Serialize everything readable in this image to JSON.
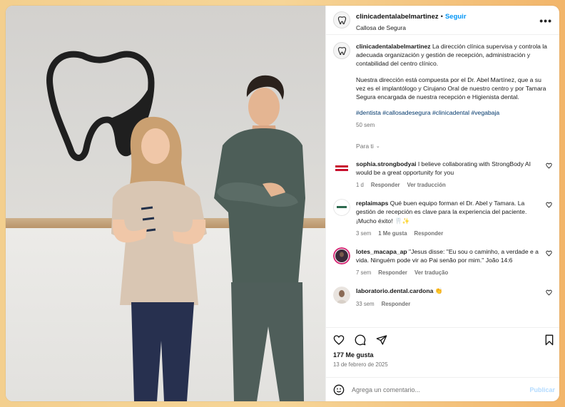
{
  "post": {
    "username": "clinicadentalabelmartinez",
    "separator": "•",
    "follow_label": "Seguir",
    "location": "Callosa de Segura",
    "more_icon": "more-horizontal-icon"
  },
  "caption": {
    "username": "clinicadentalabelmartinez",
    "text1": "La dirección clínica supervisa y controla la adecuada organización y gestión de recepción, administración y contabilidad del centro clínico.",
    "text2": "Nuestra dirección está compuesta por el Dr. Abel Martínez, que a su vez es el implantólogo y Cirujano Oral de nuestro centro y por Tamara Segura encargada de nuestra recepción e Higienista dental.",
    "hashtags": "#dentista #callosadesegura #clinicadental #vegabaja",
    "time": "50 sem"
  },
  "filter": {
    "label": "Para ti"
  },
  "comments": [
    {
      "username": "sophia.strongbodyai",
      "text": "I believe collaborating with StrongBody AI would be a great opportunity for you",
      "time": "1 d",
      "likes": "",
      "reply": "Responder",
      "translate": "Ver traducción"
    },
    {
      "username": "replaimaps",
      "text": "Qué buen equipo forman el Dr. Abel y Tamara. La gestión de recepción es clave para la experiencia del paciente. ¡Mucho éxito! 🦷✨",
      "time": "3 sem",
      "likes": "1 Me gusta",
      "reply": "Responder",
      "translate": ""
    },
    {
      "username": "lotes_macapa_ap",
      "text": "\"Jesus disse: \"Eu sou o caminho, a verdade e a vida. Ninguém pode vir ao Pai senão por mim.\" João 14:6",
      "time": "7 sem",
      "likes": "",
      "reply": "Responder",
      "translate": "Ver tradução"
    },
    {
      "username": "laboratorio.dental.cardona",
      "text": "👏",
      "time": "33 sem",
      "likes": "",
      "reply": "Responder",
      "translate": ""
    }
  ],
  "footer": {
    "likes": "177 Me gusta",
    "date": "13 de febrero de 2025",
    "comment_placeholder": "Agrega un comentario...",
    "publish_label": "Publicar"
  },
  "colors": {
    "link": "#0095f6",
    "hashtag": "#00376b",
    "muted": "#737373",
    "background_gradient": "#f3cf8e"
  }
}
